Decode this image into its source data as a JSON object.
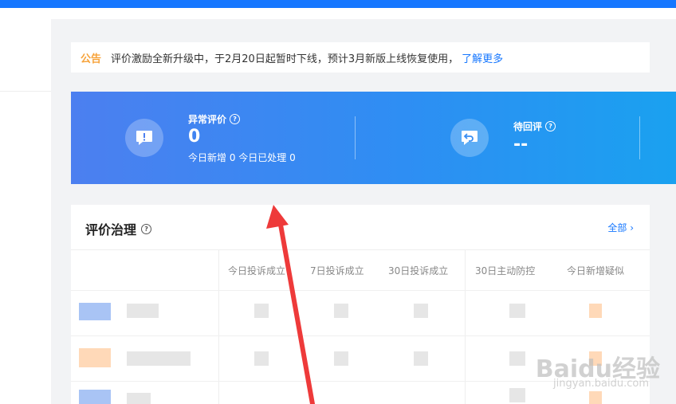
{
  "notice": {
    "tag": "公告",
    "text": "评价激励全新升级中，于2月20日起暂时下线，预计3月新版上线恢复使用，",
    "link": "了解更多"
  },
  "stats": [
    {
      "title": "异常评价",
      "value": "0",
      "sub": "今日新增 0  今日已处理 0",
      "icon": "exclamation-chat-icon"
    },
    {
      "title": "待回评",
      "value": "--",
      "sub": "",
      "icon": "reply-chat-icon"
    }
  ],
  "governance": {
    "title": "评价治理",
    "all_link": "全部",
    "columns": [
      "今日投诉成立",
      "7日投诉成立",
      "30日投诉成立",
      "30日主动防控",
      "今日新增疑似"
    ]
  },
  "watermark": {
    "brand": "Baidu经验",
    "url": "jingyan.baidu.com"
  },
  "colors": {
    "accent": "#1677ff",
    "notice_tag": "#f7a33a"
  }
}
